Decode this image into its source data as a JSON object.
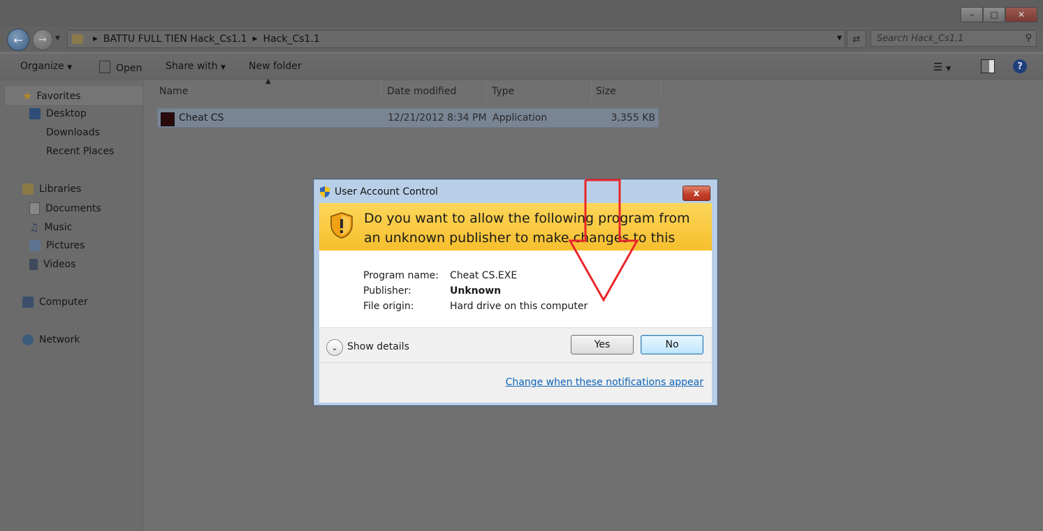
{
  "explorer": {
    "breadcrumb": [
      "BATTU FULL TIEN Hack_Cs1.1",
      "Hack_Cs1.1"
    ],
    "search_placeholder": "Search Hack_Cs1.1",
    "commands": {
      "organize": "Organize",
      "open": "Open",
      "share_with": "Share with",
      "new_folder": "New folder"
    },
    "sidebar": {
      "favorites": "Favorites",
      "desktop": "Desktop",
      "downloads": "Downloads",
      "recent_places": "Recent Places",
      "libraries": "Libraries",
      "documents": "Documents",
      "music": "Music",
      "pictures": "Pictures",
      "videos": "Videos",
      "computer": "Computer",
      "network": "Network"
    },
    "columns": {
      "name": "Name",
      "date_modified": "Date modified",
      "type": "Type",
      "size": "Size"
    },
    "file": {
      "name": "Cheat CS",
      "date_modified": "12/21/2012 8:34 PM",
      "type": "Application",
      "size": "3,355 KB"
    }
  },
  "uac": {
    "title": "User Account Control",
    "close_symbol": "x",
    "question": "Do you want to allow the following program from an unknown publisher to make changes to this computer?",
    "program_name_label": "Program name:",
    "program_name_value": "Cheat CS.EXE",
    "publisher_label": "Publisher:",
    "publisher_value": "Unknown",
    "file_origin_label": "File origin:",
    "file_origin_value": "Hard drive on this computer",
    "show_details": "Show details",
    "yes": "Yes",
    "no": "No",
    "change_link": "Change when these notifications appear"
  },
  "colors": {
    "banner": "#f6bf2d",
    "annotation_arrow": "#e8262a",
    "link": "#0b62b6"
  }
}
